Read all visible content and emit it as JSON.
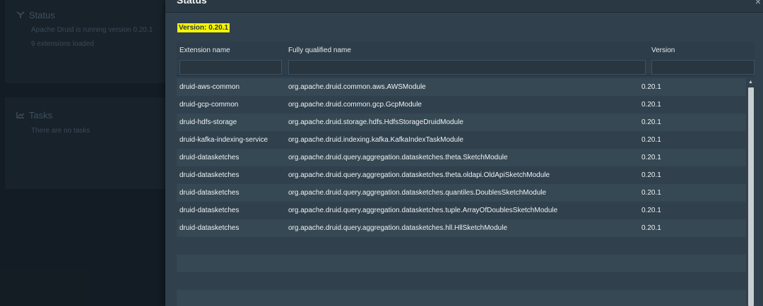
{
  "background": {
    "status_card": {
      "title": "Status",
      "lines": [
        "Apache Druid is running version 0.20.1",
        "9 extensions loaded"
      ]
    },
    "tasks_card": {
      "title": "Tasks",
      "lines": [
        "There are no tasks"
      ]
    }
  },
  "dialog": {
    "title": "Status",
    "close_glyph": "×",
    "version_label": "Version: 0.20.1",
    "columns": [
      "Extension name",
      "Fully qualified name",
      "Version"
    ],
    "filters": [
      "",
      "",
      ""
    ],
    "rows": [
      [
        "druid-aws-common",
        "org.apache.druid.common.aws.AWSModule",
        "0.20.1"
      ],
      [
        "druid-gcp-common",
        "org.apache.druid.common.gcp.GcpModule",
        "0.20.1"
      ],
      [
        "druid-hdfs-storage",
        "org.apache.druid.storage.hdfs.HdfsStorageDruidModule",
        "0.20.1"
      ],
      [
        "druid-kafka-indexing-service",
        "org.apache.druid.indexing.kafka.KafkaIndexTaskModule",
        "0.20.1"
      ],
      [
        "druid-datasketches",
        "org.apache.druid.query.aggregation.datasketches.theta.SketchModule",
        "0.20.1"
      ],
      [
        "druid-datasketches",
        "org.apache.druid.query.aggregation.datasketches.theta.oldapi.OldApiSketchModule",
        "0.20.1"
      ],
      [
        "druid-datasketches",
        "org.apache.druid.query.aggregation.datasketches.quantiles.DoublesSketchModule",
        "0.20.1"
      ],
      [
        "druid-datasketches",
        "org.apache.druid.query.aggregation.datasketches.tuple.ArrayOfDoublesSketchModule",
        "0.20.1"
      ],
      [
        "druid-datasketches",
        "org.apache.druid.query.aggregation.datasketches.hll.HllSketchModule",
        "0.20.1"
      ]
    ],
    "scroll_up_glyph": "▲"
  }
}
